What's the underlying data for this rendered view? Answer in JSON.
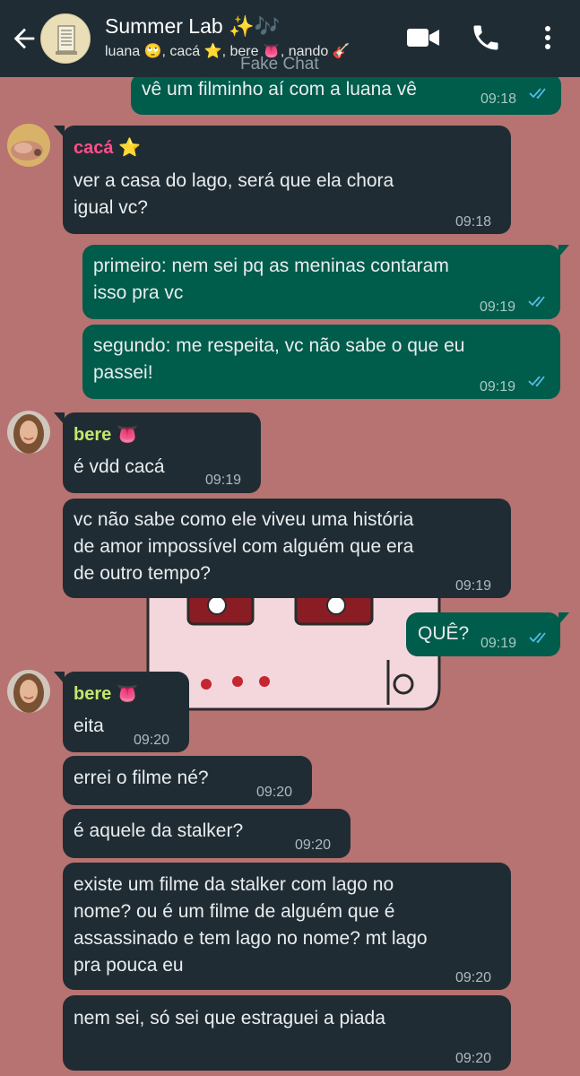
{
  "header": {
    "title": "Summer Lab ✨🎶",
    "members": "luana 🙄, cacá ⭐, bere 👅, nando 🎸",
    "watermark": "Fake Chat"
  },
  "colors": {
    "header_bg": "#1f2c34",
    "chat_bg": "#b77371",
    "incoming_bubble": "#202c33",
    "outgoing_bubble": "#005c4b",
    "read_ticks": "#53bdeb",
    "caca_name": "#ff4f8b",
    "bere_name": "#c4e86b"
  },
  "messages": [
    {
      "text": "vê um filminho aí com a luana vê",
      "time": "09:18"
    },
    {
      "sender": "cacá ⭐",
      "line1": "ver a casa do lago, será que ela chora",
      "line2": "igual vc?",
      "time": "09:18"
    },
    {
      "line1": "primeiro: nem sei pq as meninas contaram",
      "line2": "isso pra vc",
      "time": "09:19"
    },
    {
      "line1": "segundo: me respeita, vc não sabe o que eu",
      "line2": "passei!",
      "time": "09:19"
    },
    {
      "sender": "bere 👅",
      "text": "é vdd cacá",
      "time": "09:19"
    },
    {
      "line1": "vc não sabe como ele viveu uma história",
      "line2": "de amor impossível com alguém que era",
      "line3": "de outro tempo?",
      "time": "09:19"
    },
    {
      "text": "QUÊ?",
      "time": "09:19"
    },
    {
      "sender": "bere 👅",
      "text": "eita",
      "time": "09:20"
    },
    {
      "text": "errei o filme né?",
      "time": "09:20"
    },
    {
      "text": "é aquele da stalker?",
      "time": "09:20"
    },
    {
      "line1": "existe um filme da stalker com lago no",
      "line2": "nome? ou é um filme de alguém que é",
      "line3": "assassinado e tem lago no nome? mt lago",
      "line4": "pra pouca eu",
      "time": "09:20"
    },
    {
      "text": "nem sei, só sei que estraguei a piada",
      "time": "09:20"
    }
  ]
}
